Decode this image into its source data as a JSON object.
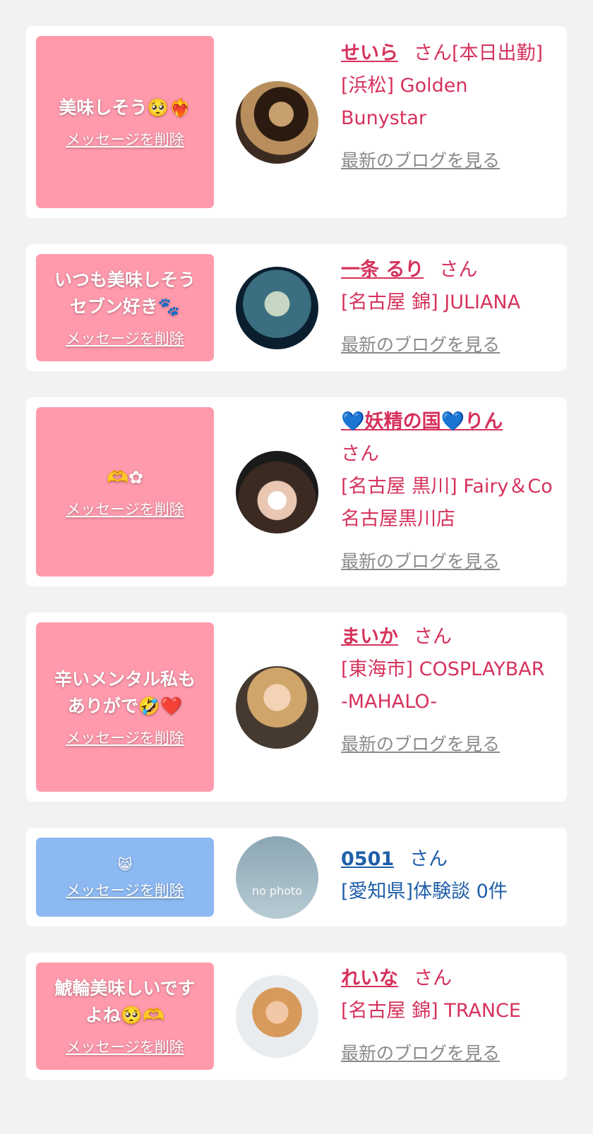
{
  "theme": {
    "pink": "#ff9aad",
    "blue": "#8db9f3",
    "name_pink": "#d6325c",
    "name_blue": "#1f5fa8"
  },
  "delete_label": "メッセージを削除",
  "san_label": "さん",
  "blog_label": "最新のブログを見る",
  "cards": [
    {
      "message": "美味しそう🥺❤️‍🔥",
      "name": "せいら",
      "status": "[本日出勤]",
      "shop": "[浜松] Golden Bunystar",
      "has_blog": true
    },
    {
      "message": "いつも美味しそう\nセブン好き🐾",
      "name": "一条 るり",
      "status": "",
      "shop": "[名古屋 錦] JULIANA",
      "has_blog": true
    },
    {
      "message": "🫶✿",
      "name": "💙妖精の国💙りん",
      "status": "",
      "shop": "[名古屋 黒川] Fairy＆Co 名古屋黒川店",
      "has_blog": true
    },
    {
      "message": "辛いメンタル私も\nありがで🤣❤️",
      "name": "まいか",
      "status": "",
      "shop": "[東海市] COSPLAYBAR -MAHALO-",
      "has_blog": true
    },
    {
      "message": "😸",
      "name": "0501",
      "status": "",
      "shop": "[愛知県]体験談 0件",
      "has_blog": false,
      "avatar_text": "no photo"
    },
    {
      "message": "鯱輪美味しいです\nよね🥺🫶",
      "name": "れいな",
      "status": "",
      "shop": "[名古屋 錦] TRANCE",
      "has_blog": true
    }
  ]
}
